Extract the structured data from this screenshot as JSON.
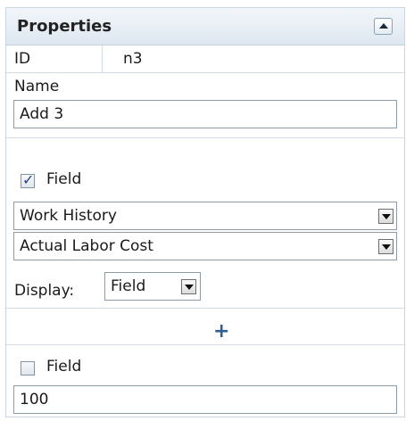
{
  "panel": {
    "title": "Properties",
    "collapse_icon": "triangle-up-icon"
  },
  "id_row": {
    "key": "ID",
    "value": "n3"
  },
  "name": {
    "label": "Name",
    "value": "Add 3"
  },
  "operand1": {
    "checkbox_label": "Field",
    "checked": true,
    "check_glyph": "✓",
    "table_value": "Work History",
    "field_value": "Actual Labor Cost",
    "display_label": "Display:",
    "display_value": "Field"
  },
  "add_glyph": "+",
  "operand2": {
    "checkbox_label": "Field",
    "checked": false,
    "value": "100"
  },
  "colors": {
    "header_bg": "#dde7f0",
    "border": "#c9d6e3",
    "plus": "#2e5f93"
  }
}
